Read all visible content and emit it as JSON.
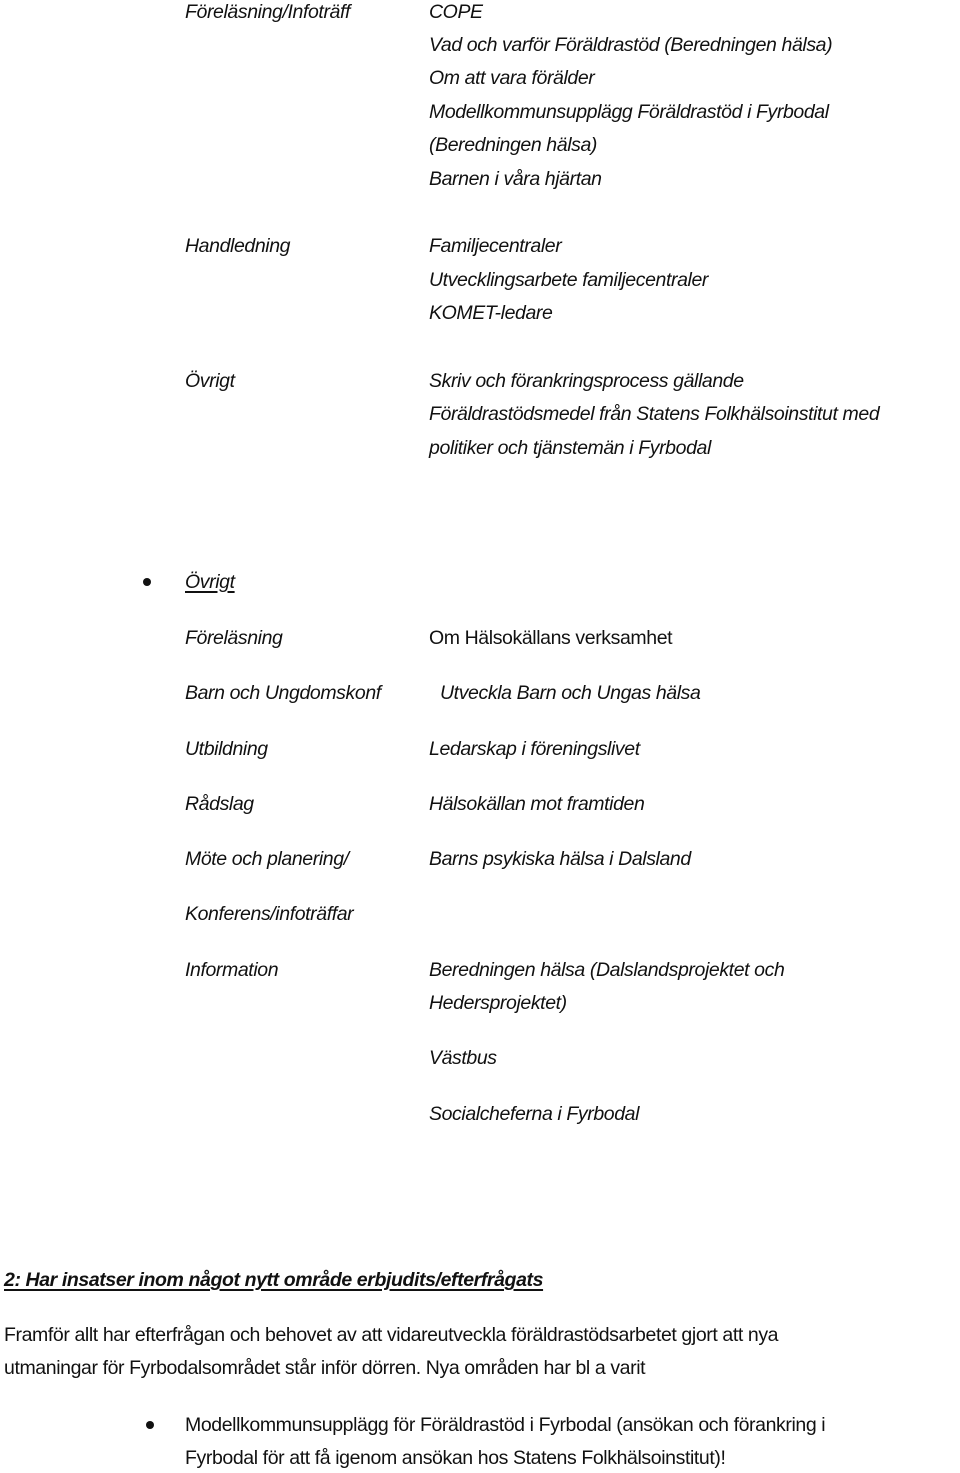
{
  "section1": {
    "groups": [
      {
        "label": "Föreläsning/Infoträff",
        "items": [
          "COPE",
          "Vad och varför Föräldrastöd (Beredningen hälsa)",
          "Om att vara förälder",
          "Modellkommunsupplägg Föräldrastöd i Fyrbodal",
          "(Beredningen hälsa)",
          "Barnen i våra hjärtan"
        ]
      },
      {
        "label": "Handledning",
        "items": [
          "Familjecentraler",
          "Utvecklingsarbete familjecentraler",
          "KOMET-ledare"
        ]
      },
      {
        "label": "Övrigt",
        "items": [
          "Skriv och förankringsprocess gällande",
          "Föräldrastödsmedel från Statens Folkhälsoinstitut med",
          "politiker och tjänstemän i Fyrbodal"
        ]
      }
    ]
  },
  "section2": {
    "heading": "Övrigt",
    "rows": [
      {
        "label": "Föreläsning",
        "value": "Om Hälsokällans verksamhet"
      },
      {
        "label": "Barn och Ungdomskonf",
        "value": "Utveckla Barn och Ungas hälsa"
      },
      {
        "label": "Utbildning",
        "value": "Ledarskap i föreningslivet"
      },
      {
        "label": "Rådslag",
        "value": "Hälsokällan mot framtiden"
      },
      {
        "label": "Möte och planering/",
        "value": "Barns psykiska hälsa i Dalsland"
      },
      {
        "label": "Konferens/infoträffar",
        "value": ""
      },
      {
        "label": "Information",
        "value": "Beredningen hälsa (Dalslandsprojektet och"
      }
    ],
    "information_continued": [
      "Hedersprojektet)",
      "Västbus",
      "Socialcheferna i Fyrbodal"
    ]
  },
  "question2": {
    "heading": "2: Har insatser inom något nytt område erbjudits/efterfrågats",
    "paragraph_lines": [
      "Framför allt har efterfrågan och behovet av att vidareutveckla föräldrastödsarbetet gjort att nya",
      "utmaningar för Fyrbodalsområdet står inför dörren.  Nya områden har bl a varit"
    ],
    "bullet_lines": [
      "Modellkommunsupplägg för Föräldrastöd i Fyrbodal (ansökan och förankring i",
      "Fyrbodal för att få igenom ansökan hos Statens Folkhälsoinstitut)!"
    ]
  }
}
